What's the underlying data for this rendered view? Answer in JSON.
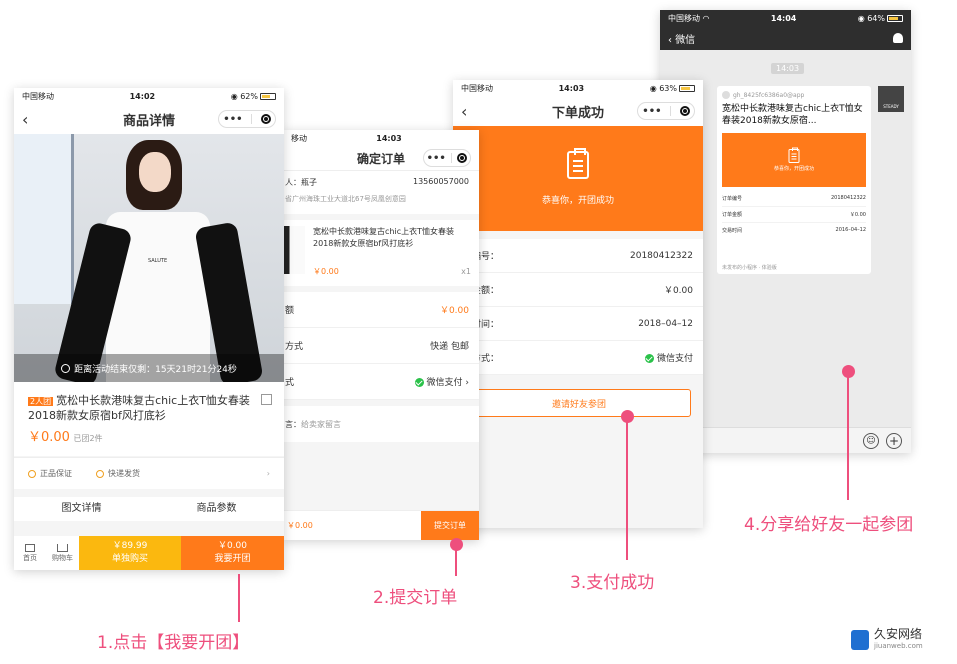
{
  "phone1": {
    "status": {
      "carrier": "中国移动",
      "time": "14:02",
      "battery": "62%"
    },
    "title": "商品详情",
    "shirt_print": "SALUTE",
    "countdown": "距离活动结束仅剩：15天21时21分24秒",
    "tag": "2人团",
    "product_name": "宽松中长款港味复古chic上衣T恤女春装2018新款女原宿bf风打底衫",
    "price": "￥0.00",
    "sold": "已团2件",
    "guarantee": "正品保证",
    "shipping": "快递发货",
    "tabs": [
      "图文详情",
      "商品参数"
    ],
    "nav_home": "首页",
    "nav_cart": "购物车",
    "single_price": "￥89.99",
    "single_label": "单独购买",
    "group_price": "￥0.00",
    "group_label": "我要开团"
  },
  "phone2": {
    "status": {
      "carrier": "移动",
      "time": "14:03"
    },
    "title": "确定订单",
    "recipient_label": "人：瓶子",
    "phone": "13560057000",
    "address": "省广州海珠工业大道北67号凤凰创意园",
    "product_name": "宽松中长款港味复古chic上衣T恤女春装2018新款女原宿bf风打底衫",
    "price": "￥0.00",
    "qty": "x1",
    "amount_label": "额",
    "amount_value": "￥0.00",
    "delivery_label": "方式",
    "delivery_value": "快递  包邮",
    "pay_label": "式",
    "pay_value": "微信支付",
    "note_label": "言：",
    "note_placeholder": "给卖家留言",
    "total": "￥0.00",
    "submit": "提交订单"
  },
  "phone3": {
    "status": {
      "carrier": "中国移动",
      "time": "14:03",
      "battery": "63%"
    },
    "title": "下单成功",
    "banner_text": "恭喜你，开团成功",
    "order_no_label": "单编号：",
    "order_no": "20180412322",
    "amount_label": "单金额：",
    "amount": "￥0.00",
    "time_label": "易时间：",
    "time_value": "2018–04–12",
    "pay_label": "付方式：",
    "pay_value": "微信支付",
    "invite": "邀请好友参团"
  },
  "phone4": {
    "status": {
      "carrier": "中国移动",
      "time": "14:04",
      "battery": "64%"
    },
    "title": "微信",
    "time_chip": "14:03",
    "sender": "gh_8425fc6386a0@app",
    "card_title": "宽松中长款港味复古chic上衣T恤女春装2018新款女原宿...",
    "card_banner": "恭喜你，开团成功",
    "order_label": "订单编号",
    "order_value": "20180412322",
    "amount_label": "订单金额",
    "amount_value": "￥0.00",
    "time_label": "交易时间",
    "time_value": "2016–04–12",
    "footer": "未发布的小程序 · 体验版",
    "avatar_text": "STEADY"
  },
  "captions": {
    "step1": "1.点击【我要开团】",
    "step2": "2.提交订单",
    "step3": "3.支付成功",
    "step4": "4.分享给好友一起参团"
  },
  "watermark": {
    "name": "久安网络",
    "url": "jiuanweb.com"
  },
  "colors": {
    "orange": "#ff7a1a",
    "yellow": "#fbb80f",
    "accent": "#ee4f7d",
    "wechat_green": "#2bc24a"
  }
}
